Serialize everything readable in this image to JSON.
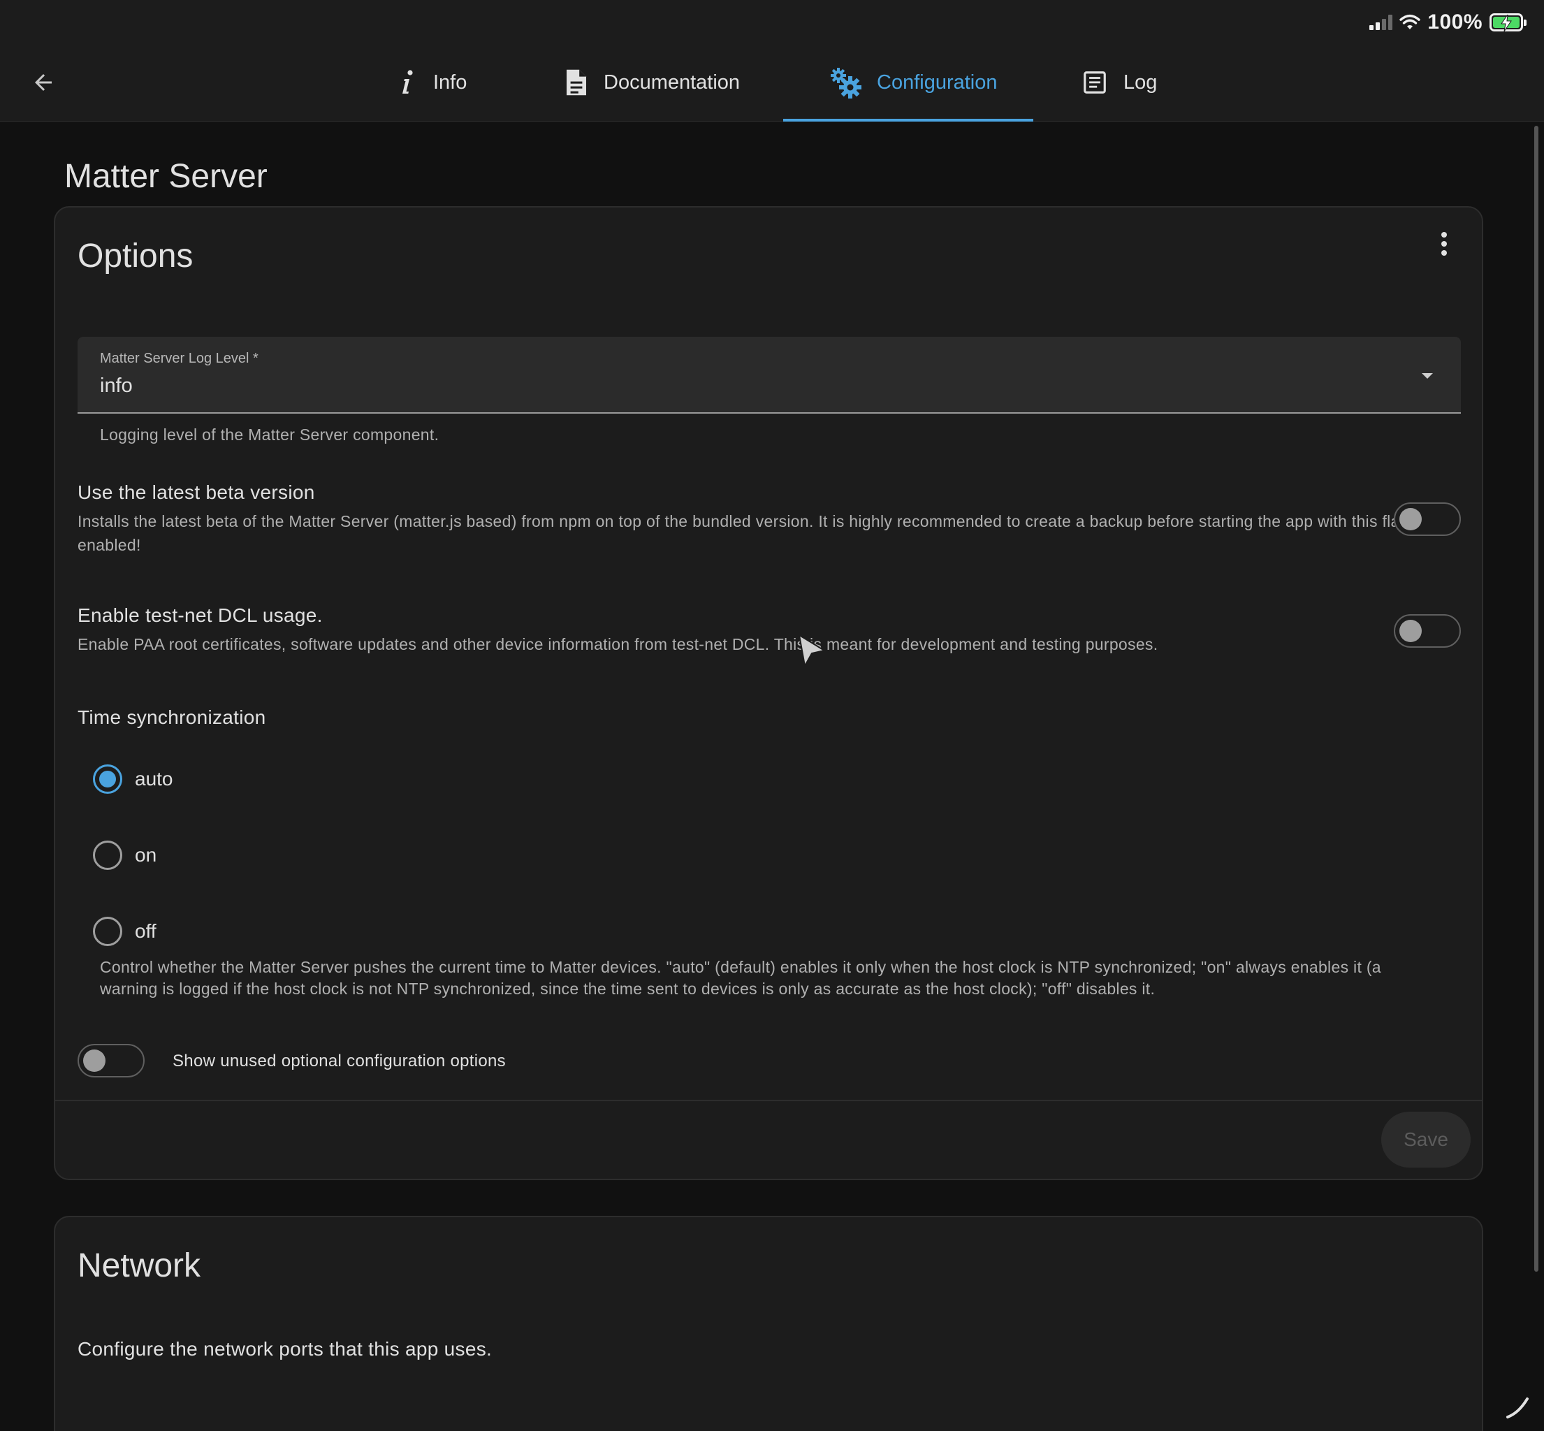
{
  "status_bar": {
    "battery_percent": "100%",
    "signal_bars": 4,
    "signal_active": 2
  },
  "tabs": [
    {
      "label": "Info",
      "icon": "info-icon",
      "active": false
    },
    {
      "label": "Documentation",
      "icon": "document-icon",
      "active": false
    },
    {
      "label": "Configuration",
      "icon": "gears-icon",
      "active": true
    },
    {
      "label": "Log",
      "icon": "log-icon",
      "active": false
    }
  ],
  "page": {
    "title": "Matter Server"
  },
  "options": {
    "title": "Options",
    "log_level": {
      "label": "Matter Server Log Level *",
      "value": "info",
      "helper": "Logging level of the Matter Server component."
    },
    "beta": {
      "title": "Use the latest beta version",
      "description": "Installs the latest beta of the Matter Server (matter.js based) from npm on top of the bundled version. It is highly recommended to create a backup before starting the app with this flag enabled!",
      "enabled": false
    },
    "testnet": {
      "title": "Enable test-net DCL usage.",
      "description": "Enable PAA root certificates, software updates and other device information from test-net DCL. This is meant for development and testing purposes.",
      "enabled": false
    },
    "time_sync": {
      "title": "Time synchronization",
      "options": [
        "auto",
        "on",
        "off"
      ],
      "selected": "auto",
      "helper": "Control whether the Matter Server pushes the current time to Matter devices. \"auto\" (default) enables it only when the host clock is NTP synchronized; \"on\" always enables it (a warning is logged if the host clock is not NTP synchronized, since the time sent to devices is only as accurate as the host clock); \"off\" disables it."
    },
    "show_unused": {
      "label": "Show unused optional configuration options",
      "enabled": false
    },
    "save_label": "Save"
  },
  "network": {
    "title": "Network",
    "description": "Configure the network ports that this app uses."
  },
  "colors": {
    "accent": "#4aa3df",
    "background": "#111111",
    "card": "#1c1c1c"
  }
}
